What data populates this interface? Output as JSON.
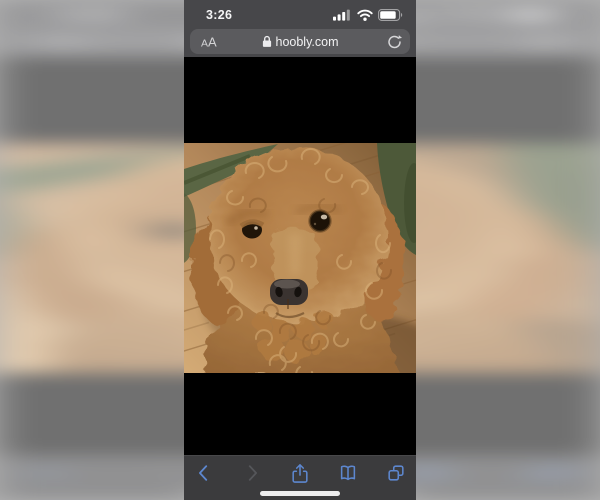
{
  "page": {
    "description": "iPhone Safari screenshot of a puppy photo on hoobly.com, centered over a blurred stretched backdrop of itself"
  },
  "status_bar": {
    "time": "3:26",
    "signal_icon": "cellular-signal-icon",
    "wifi_icon": "wifi-icon",
    "battery_icon": "battery-icon"
  },
  "address_bar": {
    "reader_button_label": "AA",
    "lock_icon": "padlock-icon",
    "url": "hoobly.com",
    "reload_icon": "reload-icon"
  },
  "photo": {
    "subject": "Close-up of a curly apricot-red poodle puppy with dark eyes and black nose sitting on a wooden floor with a dark green blanket in the corners"
  },
  "toolbar": {
    "back_icon": "chevron-left-icon",
    "forward_icon": "chevron-right-icon",
    "share_icon": "share-icon",
    "bookmarks_icon": "open-book-icon",
    "tabs_icon": "stacked-squares-icon"
  },
  "colors": {
    "accent_blue": "#5d87cf",
    "disabled_gray": "#55565a",
    "chrome_gray": "#47474a",
    "pill_gray": "#5b5b5e",
    "toolbar_gray": "#3b3b3d",
    "content_black": "#000000",
    "home_indicator": "#ededee",
    "backdrop_dim": "rgba(255,255,255,0.44)"
  }
}
